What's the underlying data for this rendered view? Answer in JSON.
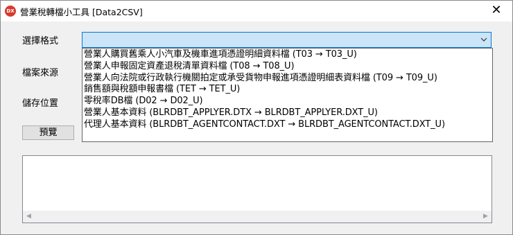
{
  "window": {
    "title": "營業稅轉檔小工具 [Data2CSV]",
    "app_icon_text": "DX",
    "close_glyph": "✕"
  },
  "form": {
    "format_label": "選擇格式",
    "source_label": "檔案來源",
    "save_label": "儲存位置",
    "preview_button": "預覽"
  },
  "dropdown": {
    "selected_value": "",
    "items": [
      "營業人購買舊乘人小汽車及機車進項憑證明細資料檔 (T03 → T03_U)",
      "營業人申報固定資產退稅清單資料檔 (T08 → T08_U)",
      "營業人向法院或行政執行機關拍定或承受貨物申報進項憑證明細表資料檔 (T09 → T09_U)",
      "銷售額與稅額申報書檔 (TET → TET_U)",
      "零稅率DB檔 (D02 → D02_U)",
      "營業人基本資料 (BLRDBT_APPLYER.DTX → BLRDBT_APPLYER.DXT_U)",
      "代理人基本資料 (BLRDBT_AGENTCONTACT.DXT → BLRDBT_AGENTCONTACT.DXT_U)"
    ]
  },
  "preview": {
    "text": ""
  },
  "icons": {
    "app": "app-logo-icon",
    "close": "close-icon",
    "chevron": "chevron-down-icon",
    "scroll_left": "scroll-left-icon",
    "scroll_right": "scroll-right-icon"
  }
}
